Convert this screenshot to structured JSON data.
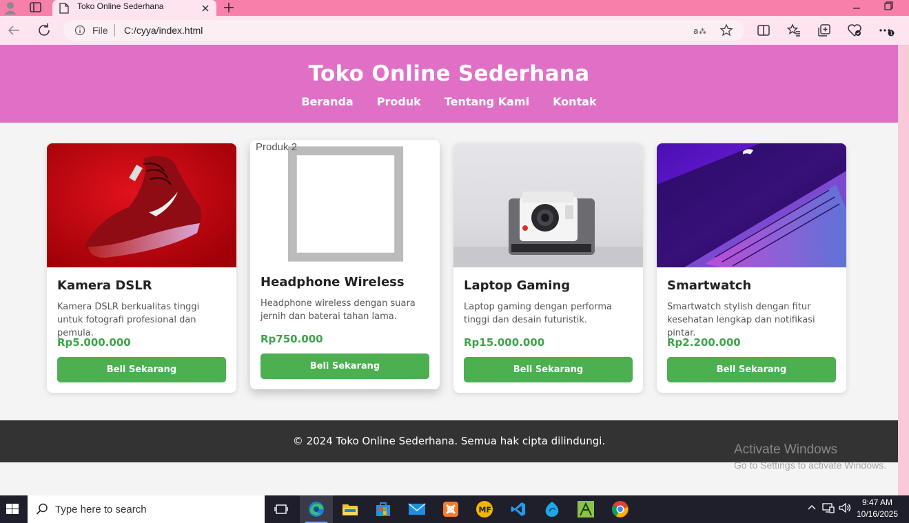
{
  "browser": {
    "tab_title": "Toko Online Sederhana",
    "address_scheme": "File",
    "address_url": "C:/cyya/index.html",
    "colors": {
      "tab_strip": "#f77fa9",
      "toolbar": "#fde4ee"
    }
  },
  "site": {
    "title": "Toko Online Sederhana",
    "nav": [
      "Beranda",
      "Produk",
      "Tentang Kami",
      "Kontak"
    ],
    "products": [
      {
        "name": "Kamera DSLR",
        "description": "Kamera DSLR berkualitas tinggi untuk fotografi profesional dan pemula.",
        "price": "Rp5.000.000",
        "button": "Beli Sekarang",
        "image": "red-sneaker"
      },
      {
        "name": "Headphone Wireless",
        "description": "Headphone wireless dengan suara jernih dan baterai tahan lama.",
        "price": "Rp750.000",
        "button": "Beli Sekarang",
        "image_alt": "Produk 2",
        "image": "broken"
      },
      {
        "name": "Laptop Gaming",
        "description": "Laptop gaming dengan performa tinggi dan desain futuristik.",
        "price": "Rp15.000.000",
        "button": "Beli Sekarang",
        "image": "polaroid-camera"
      },
      {
        "name": "Smartwatch",
        "description": "Smartwatch stylish dengan fitur kesehatan lengkap dan notifikasi pintar.",
        "price": "Rp2.200.000",
        "button": "Beli Sekarang",
        "image": "purple-laptop"
      }
    ],
    "footer": "© 2024 Toko Online Sederhana. Semua hak cipta dilindungi.",
    "colors": {
      "header": "#e070c6",
      "button": "#4caf50",
      "price": "#3ea34a",
      "footer": "#333333"
    }
  },
  "watermark": {
    "title": "Activate Windows",
    "subtitle": "Go to Settings to activate Windows."
  },
  "taskbar": {
    "search_placeholder": "Type here to search",
    "time": "9:47 AM",
    "date": "10/16/2025",
    "apps": [
      "task-view",
      "edge",
      "file-explorer",
      "store",
      "mail",
      "xampp",
      "mf",
      "vscode",
      "app-blue",
      "app-green",
      "chrome"
    ]
  }
}
